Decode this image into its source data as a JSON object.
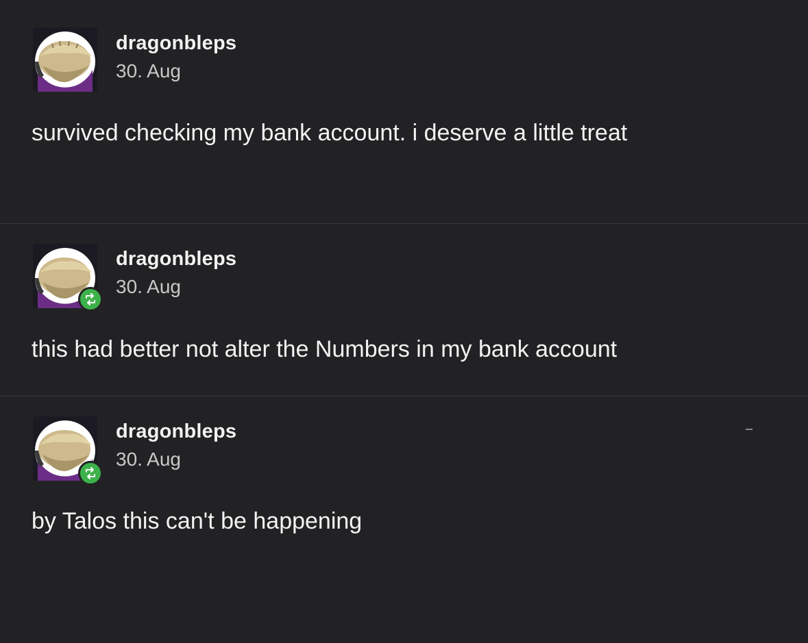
{
  "posts": [
    {
      "username": "dragonbleps",
      "date": "30. Aug",
      "text": "survived checking my bank account. i deserve a little treat",
      "reblogged": false
    },
    {
      "username": "dragonbleps",
      "date": "30. Aug",
      "text": "this had better not alter the Numbers in my bank account",
      "reblogged": true
    },
    {
      "username": "dragonbleps",
      "date": "30. Aug",
      "text": "by Talos this can't be happening",
      "reblogged": true
    }
  ],
  "colors": {
    "background": "#222224",
    "reblog_badge": "#3db14a",
    "divider": "#3a3a3c"
  },
  "icons": {
    "avatar": "avatar-image",
    "reblog": "reblog-icon"
  }
}
